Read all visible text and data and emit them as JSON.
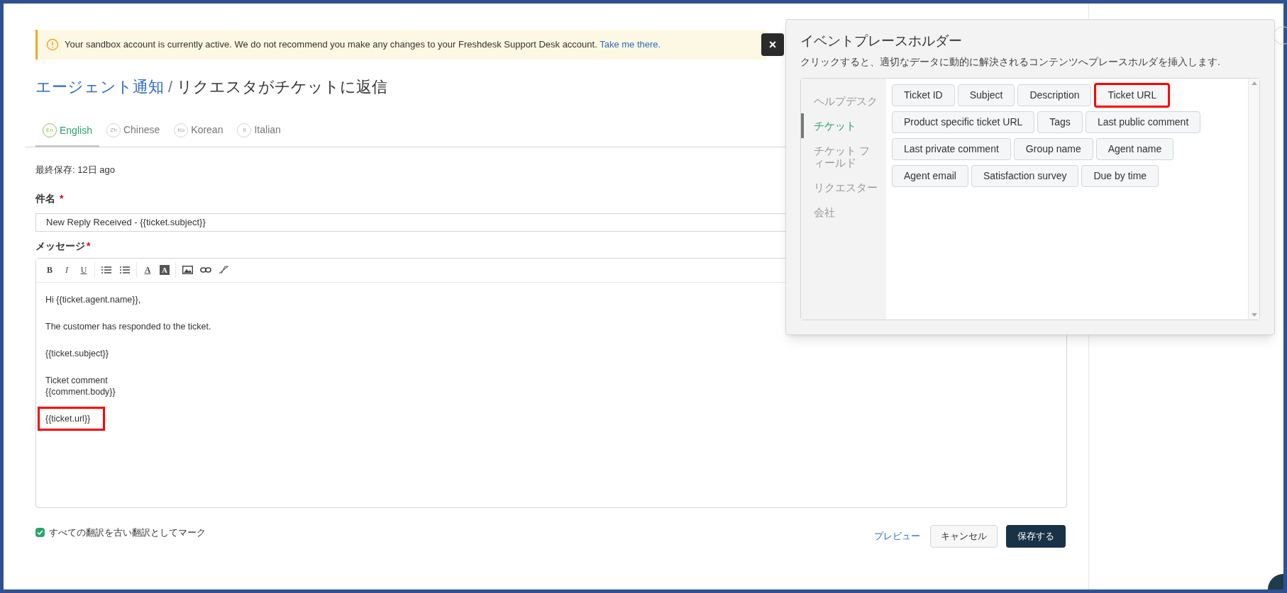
{
  "banner": {
    "text": "Your sandbox account is currently active. We do not recommend you make any changes to your Freshdesk Support Desk account.",
    "link": "Take me there.",
    "close": "×"
  },
  "breadcrumb": {
    "parent": "エージェント通知",
    "separator": "/",
    "current": "リクエスタがチケットに返信"
  },
  "tabs": [
    {
      "badge": "En",
      "label": "English",
      "selected": true
    },
    {
      "badge": "Zh",
      "label": "Chinese",
      "selected": false
    },
    {
      "badge": "Ko",
      "label": "Korean",
      "selected": false
    },
    {
      "badge": "It",
      "label": "Italian",
      "selected": false
    }
  ],
  "last_saved": "最終保存: 12日 ago",
  "subject": {
    "label": "件名",
    "required": "*",
    "value": "New Reply Received - {{ticket.subject}}"
  },
  "message": {
    "label": "メッセージ",
    "required": "*",
    "toolbar": [
      [
        {
          "kind": "bold",
          "label": "B"
        },
        {
          "kind": "italic",
          "label": "I"
        },
        {
          "kind": "underline",
          "label": "U"
        }
      ],
      [
        {
          "kind": "bullets"
        },
        {
          "kind": "numbers"
        }
      ],
      [
        {
          "kind": "text-color",
          "label": "A"
        },
        {
          "kind": "bg-color",
          "label": "A"
        }
      ],
      [
        {
          "kind": "image"
        },
        {
          "kind": "link"
        },
        {
          "kind": "clear-format"
        }
      ]
    ],
    "paragraphs": [
      {
        "lines": [
          "Hi {{ticket.agent.name}},"
        ],
        "highlighted": false
      },
      {
        "lines": [
          "The customer has responded to the ticket."
        ],
        "highlighted": false
      },
      {
        "lines": [
          "{{ticket.subject}}"
        ],
        "highlighted": false
      },
      {
        "lines": [
          "Ticket comment",
          "{{comment.body}}"
        ],
        "highlighted": false
      },
      {
        "lines": [
          "{{ticket.url}}"
        ],
        "highlighted": true
      }
    ]
  },
  "mark_outdated": {
    "label": "すべての翻訳を古い翻訳としてマーク",
    "checked": true
  },
  "actions": {
    "preview": "プレビュー",
    "cancel": "キャンセル",
    "save": "保存する"
  },
  "placeholder_popup": {
    "title": "イベントプレースホルダー",
    "description": "クリックすると、適切なデータに動的に解決されるコンテンツへプレースホルダを挿入します.",
    "categories": [
      {
        "label": "ヘルプデスク",
        "selected": false
      },
      {
        "label": "チケット",
        "selected": true
      },
      {
        "label": "チケット フィールド",
        "selected": false
      },
      {
        "label": "リクエスター",
        "selected": false
      },
      {
        "label": "会社",
        "selected": false
      }
    ],
    "placeholders": [
      {
        "label": "Ticket ID",
        "highlighted": false
      },
      {
        "label": "Subject",
        "highlighted": false
      },
      {
        "label": "Description",
        "highlighted": false
      },
      {
        "label": "Ticket URL",
        "highlighted": true
      },
      {
        "label": "Product specific ticket URL",
        "highlighted": false
      },
      {
        "label": "Tags",
        "highlighted": false
      },
      {
        "label": "Last public comment",
        "highlighted": false
      },
      {
        "label": "Last private comment",
        "highlighted": false
      },
      {
        "label": "Group name",
        "highlighted": false
      },
      {
        "label": "Agent name",
        "highlighted": false
      },
      {
        "label": "Agent email",
        "highlighted": false
      },
      {
        "label": "Satisfaction survey",
        "highlighted": false
      },
      {
        "label": "Due by time",
        "highlighted": false
      }
    ]
  }
}
